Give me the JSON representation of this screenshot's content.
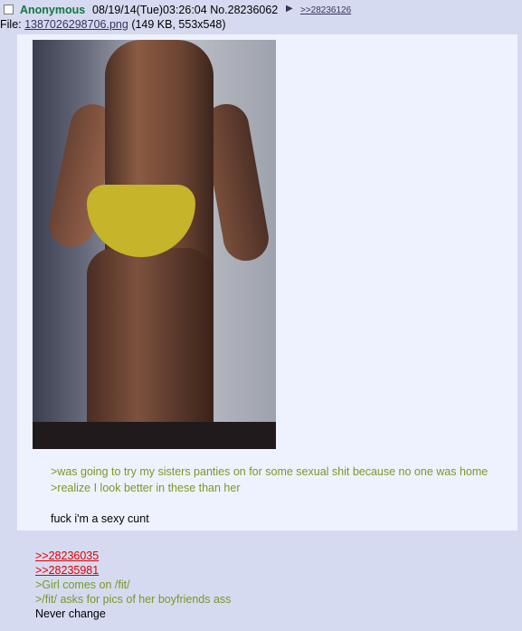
{
  "post": {
    "name": "Anonymous",
    "datetime": "08/19/14(Tue)03:26:04 No.28236062",
    "backlink": ">>28236126",
    "file_label": "File:",
    "file_link": "1387026298706.png",
    "file_meta": "(149 KB, 553x548)"
  },
  "reply": {
    "lines": [
      ">was going to try my sisters panties on for some sexual shit because no one was home",
      ">realize I look better in these than her",
      "fuck i'm a sexy cunt"
    ]
  },
  "comment": {
    "quote_links": [
      ">>28236035",
      ">>28235981"
    ],
    "greentext": [
      ">Girl comes on /fit/",
      ">/fit/ asks for pics of her boyfriends ass"
    ],
    "closing": "Never change"
  },
  "colors": {
    "background": "#d6daf0",
    "name": "#117743",
    "greentext": "#789922",
    "quote_link": "#dd0000"
  }
}
